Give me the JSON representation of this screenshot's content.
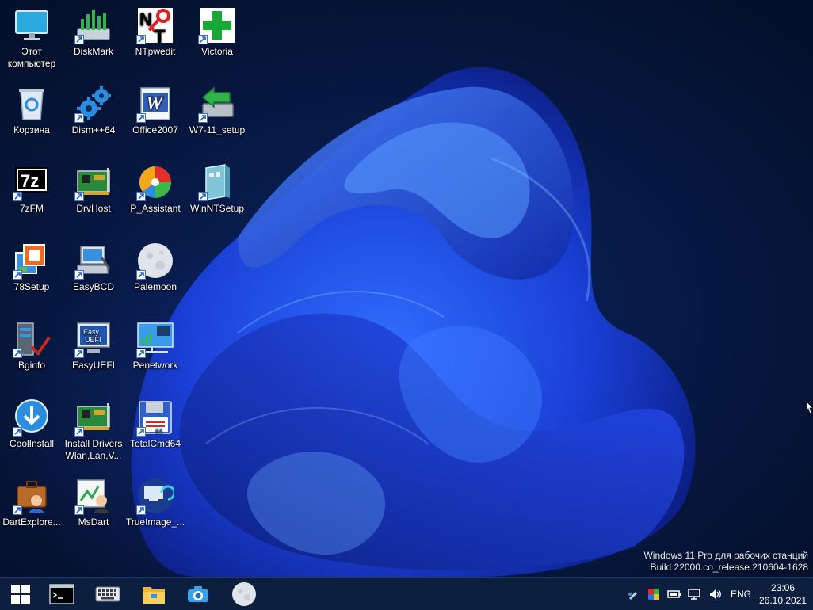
{
  "desktop": {
    "icons": [
      {
        "label": "Этот\nкомпьютер",
        "icon": "monitor-icon",
        "shortcut": false
      },
      {
        "label": "Корзина",
        "icon": "recycle-bin-icon",
        "shortcut": false
      },
      {
        "label": "7zFM",
        "icon": "sevenzip-icon",
        "shortcut": true
      },
      {
        "label": "78Setup",
        "icon": "windows-setup-icon",
        "shortcut": true
      },
      {
        "label": "Bginfo",
        "icon": "server-check-icon",
        "shortcut": true
      },
      {
        "label": "CoolInstall",
        "icon": "download-circle-icon",
        "shortcut": true
      },
      {
        "label": "DartExplore...",
        "icon": "briefcase-user-icon",
        "shortcut": true
      },
      {
        "label": "DiskMark",
        "icon": "diskmark-icon",
        "shortcut": true
      },
      {
        "label": "Dism++64",
        "icon": "gears-icon",
        "shortcut": true
      },
      {
        "label": "DrvHost",
        "icon": "circuit-board-icon",
        "shortcut": true
      },
      {
        "label": "EasyBCD",
        "icon": "computer-repair-icon",
        "shortcut": true
      },
      {
        "label": "EasyUEFI",
        "icon": "uefi-monitor-icon",
        "shortcut": true
      },
      {
        "label": "Install Drivers\nWlan,Lan,V...",
        "icon": "circuit-board-icon",
        "shortcut": true
      },
      {
        "label": "MsDart",
        "icon": "chart-user-icon",
        "shortcut": true
      },
      {
        "label": "NTpwedit",
        "icon": "nt-key-icon",
        "shortcut": true
      },
      {
        "label": "Office2007",
        "icon": "word-icon",
        "shortcut": true
      },
      {
        "label": "P_Assistant",
        "icon": "partition-disk-icon",
        "shortcut": true
      },
      {
        "label": "Palemoon",
        "icon": "moon-icon",
        "shortcut": true
      },
      {
        "label": "Penetwork",
        "icon": "network-monitor-icon",
        "shortcut": true
      },
      {
        "label": "TotalCmd64",
        "icon": "floppy-icon",
        "shortcut": true
      },
      {
        "label": "TrueImage_...",
        "icon": "backup-monitor-icon",
        "shortcut": true
      },
      {
        "label": "Victoria",
        "icon": "green-cross-icon",
        "shortcut": true
      },
      {
        "label": "W7-11_setup",
        "icon": "install-drive-icon",
        "shortcut": true
      },
      {
        "label": "WinNTSetup",
        "icon": "setup-box-icon",
        "shortcut": true
      }
    ],
    "watermark": {
      "line1": "Windows 11 Pro для рабочих станций",
      "line2": "Build 22000.co_release.210604-1628"
    }
  },
  "taskbar": {
    "buttons": [
      {
        "name": "start-button",
        "icon": "windows-logo-icon"
      },
      {
        "name": "cmd-button",
        "icon": "console-icon"
      },
      {
        "name": "keyboard-button",
        "icon": "keyboard-icon"
      },
      {
        "name": "explorer-button",
        "icon": "folder-icon"
      },
      {
        "name": "camera-button",
        "icon": "camera-icon"
      },
      {
        "name": "palemoon-button",
        "icon": "moon-icon"
      }
    ],
    "tray": {
      "icons": [
        "pen-icon",
        "color-icon",
        "battery-icon",
        "network-icon",
        "volume-icon"
      ],
      "language": "ENG",
      "time": "23:06",
      "date": "26.10.2021"
    }
  }
}
